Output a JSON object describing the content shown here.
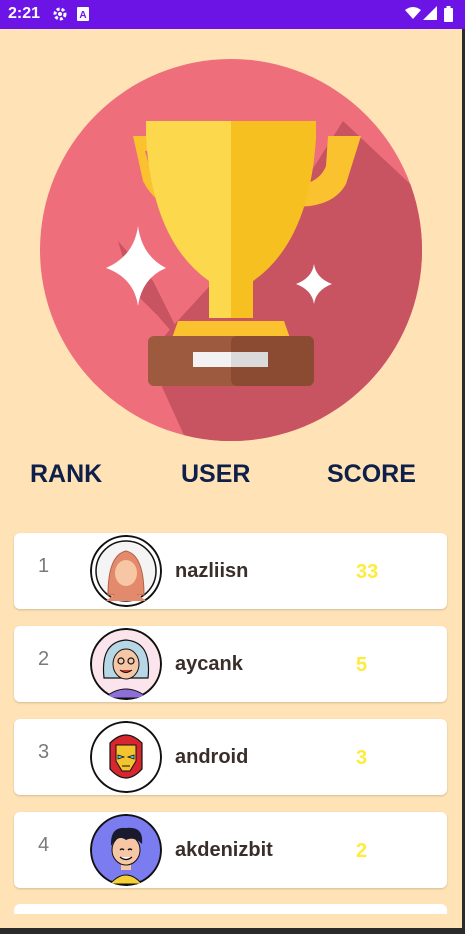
{
  "status": {
    "time": "2:21",
    "icons": [
      "settings-icon",
      "a-badge-icon",
      "wifi-icon",
      "signal-icon",
      "battery-icon"
    ]
  },
  "headers": {
    "rank": "RANK",
    "user": "USER",
    "score": "SCORE"
  },
  "rows": [
    {
      "rank": "1",
      "user": "nazliisn",
      "score": "33",
      "avatar": "woman-avatar-icon"
    },
    {
      "rank": "2",
      "user": "aycank",
      "score": "5",
      "avatar": "grandma-avatar-icon"
    },
    {
      "rank": "3",
      "user": "android",
      "score": "3",
      "avatar": "ironman-avatar-icon"
    },
    {
      "rank": "4",
      "user": "akdenizbit",
      "score": "2",
      "avatar": "man-avatar-icon"
    }
  ],
  "colors": {
    "background": "#FFE3B6",
    "status_bar": "#6C14E6",
    "header_text": "#0E1F49",
    "score": "#FFEB3B"
  }
}
